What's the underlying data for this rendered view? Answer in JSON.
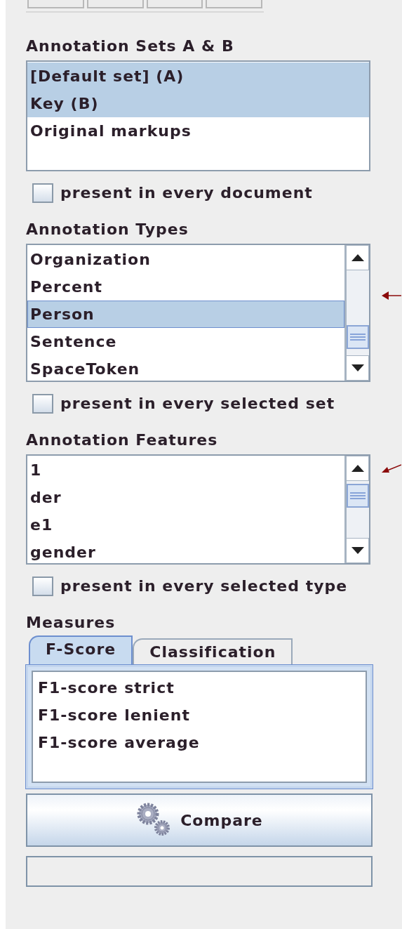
{
  "toolbar": {
    "buttons": [
      {
        "kind": "tool"
      },
      {
        "kind": "tool"
      },
      {
        "kind": "tool"
      },
      {
        "kind": "tool"
      }
    ]
  },
  "annotation_sets": {
    "heading": "Annotation Sets A & B",
    "items": [
      {
        "label": "[Default set] (A)",
        "selected": true
      },
      {
        "label": "Key (B)",
        "selected": true
      },
      {
        "label": "Original markups",
        "selected": false
      }
    ],
    "option": {
      "label": "present in every document",
      "checked": false
    }
  },
  "annotation_types": {
    "heading": "Annotation Types",
    "items": [
      {
        "label": "Organization",
        "selected": false
      },
      {
        "label": "Percent",
        "selected": false
      },
      {
        "label": "Person",
        "selected": true
      },
      {
        "label": "Sentence",
        "selected": false
      },
      {
        "label": "SpaceToken",
        "selected": false
      }
    ],
    "option": {
      "label": "present in every selected set",
      "checked": false
    }
  },
  "annotation_features": {
    "heading": "Annotation Features",
    "items": [
      {
        "label": "1",
        "selected": false
      },
      {
        "label": "der",
        "selected": false
      },
      {
        "label": "e1",
        "selected": false
      },
      {
        "label": "gender",
        "selected": false
      }
    ],
    "option": {
      "label": "present in every selected type",
      "checked": false
    }
  },
  "measures": {
    "heading": "Measures",
    "tabs": [
      {
        "label": "F-Score",
        "selected": true
      },
      {
        "label": "Classification",
        "selected": false
      }
    ],
    "items": [
      {
        "label": "F1-score strict",
        "selected": false
      },
      {
        "label": "F1-score lenient",
        "selected": false
      },
      {
        "label": "F1-score average",
        "selected": false
      }
    ]
  },
  "compare_button": {
    "label": "Compare"
  }
}
